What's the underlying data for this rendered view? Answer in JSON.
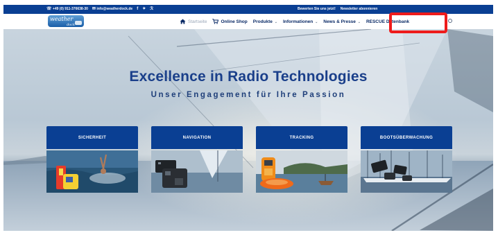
{
  "topbar": {
    "phone": "+49 (0) 911-376638-30",
    "email": "info@weatherdock.de",
    "social": [
      "facebook-icon",
      "twitter-icon",
      "rss-icon"
    ],
    "links": [
      "Bewerten Sie uns jetzt!",
      "Newsletter abonnieren"
    ]
  },
  "header": {
    "logo_text": "weather",
    "logo_subtext": "dock"
  },
  "nav": {
    "items": [
      {
        "label": "Startseite",
        "icon": "home-icon",
        "active": true
      },
      {
        "label": "Online Shop",
        "icon": "cart-icon"
      },
      {
        "label": "Produkte",
        "dropdown": true
      },
      {
        "label": "Informationen",
        "dropdown": true
      },
      {
        "label": "News & Presse",
        "dropdown": true
      },
      {
        "label": "RESCUE Datenbank"
      }
    ]
  },
  "hero": {
    "title": "Excellence in Radio Technologies",
    "subtitle": "Unser Engagement für Ihre Passion"
  },
  "cards": [
    {
      "label": "SICHERHEIT"
    },
    {
      "label": "NAVIGATION"
    },
    {
      "label": "TRACKING"
    },
    {
      "label": "BOOTSÜBERWACHUNG"
    }
  ],
  "colors": {
    "brand_blue": "#0a3f93",
    "highlight_red": "#ee1b1b",
    "title_blue": "#1a3f8a"
  }
}
